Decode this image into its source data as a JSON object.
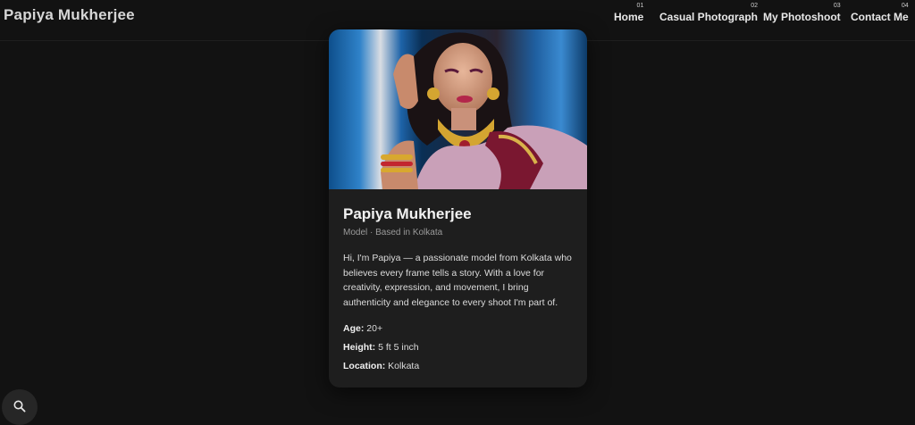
{
  "header": {
    "brand": "Papiya Mukherjee",
    "nav": [
      {
        "num": "01",
        "label": "Home"
      },
      {
        "num": "02",
        "label": "Casual Photograph"
      },
      {
        "num": "03",
        "label": "My Photoshoot"
      },
      {
        "num": "04",
        "label": "Contact Me"
      }
    ]
  },
  "profile": {
    "name": "Papiya Mukherjee",
    "meta": "Model · Based in Kolkata",
    "bio": "Hi, I'm Papiya — a passionate model from Kolkata who believes every frame tells a story. With a love for creativity, expression, and movement, I bring authenticity and elegance to every shoot I'm part of.",
    "facts": [
      {
        "label": "Age:",
        "value": "20+"
      },
      {
        "label": "Height:",
        "value": "5 ft 5 inch"
      },
      {
        "label": "Location:",
        "value": "Kolkata"
      }
    ]
  },
  "icons": {
    "search": "search-icon"
  },
  "colors": {
    "background": "#121212",
    "card": "#1e1e1e"
  }
}
